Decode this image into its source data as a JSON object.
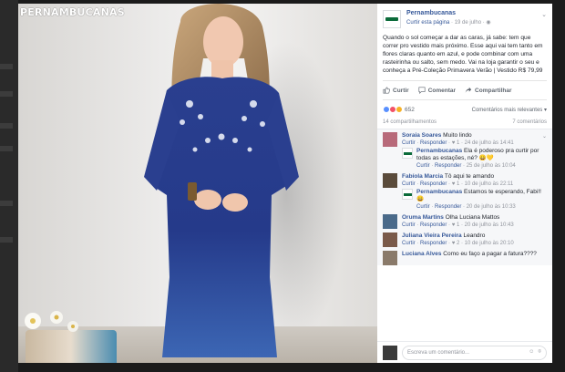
{
  "photo": {
    "brand_logo": "PERNAMBUCANAS"
  },
  "post": {
    "page_name": "Pernambucanas",
    "like_page": "Curtir esta página",
    "date": "· 19 de julho · ",
    "text": "Quando o sol começar a dar as caras, já sabe: tem que correr pro vestido mais próximo. Esse aqui vai tem tanto em flores claras quanto em azul, e pode combinar com uma rasteirinha ou salto, sem medo. Vai na loja garantir o seu e conheça a Pré-Coleção Primavera Verão | Vestido R$ 79,99",
    "actions": {
      "like": "Curtir",
      "comment": "Comentar",
      "share": "Compartilhar"
    },
    "reaction_count": "652",
    "sort_label": "Comentários mais relevantes ▾",
    "shares": "14 compartilhamentos",
    "comments_count": "7 comentários"
  },
  "comments": [
    {
      "name": "Soraia Soares",
      "text": "Muito lindo",
      "meta_like": "Curtir",
      "meta_reply": "Responder",
      "meta_rest": "· ♥ 1 · 24 de julho às 14:41",
      "avatar_color": "#b86a7a",
      "reply": {
        "name": "Pernambucanas",
        "text": "Ela é poderoso pra curtir por todas as estações, né? 😄💛",
        "meta_like": "Curtir",
        "meta_reply": "Responder",
        "meta_rest": "· 25 de julho às 10:04"
      }
    },
    {
      "name": "Fabíola Marcia",
      "text": "Tô aqui te amando",
      "meta_like": "Curtir",
      "meta_reply": "Responder",
      "meta_rest": "· ♥ 1 · 10 de julho às 22:11",
      "avatar_color": "#5a4b3b",
      "reply": {
        "name": "Pernambucanas",
        "text": "Estamos te esperando, Fabi!! 😄",
        "meta_like": "Curtir",
        "meta_reply": "Responder",
        "meta_rest": "· 20 de julho às 10:33"
      }
    },
    {
      "name": "Oruma Martins",
      "text": "Olha Luciana Mattos",
      "meta_like": "Curtir",
      "meta_reply": "Responder",
      "meta_rest": "· ♥ 1 · 20 de julho às 10:43",
      "avatar_color": "#4a6a8a"
    },
    {
      "name": "Juliana Vieira Pereira",
      "text": "Leandro",
      "meta_like": "Curtir",
      "meta_reply": "Responder",
      "meta_rest": "· ♥ 2 · 10 de julho às 20:10",
      "avatar_color": "#7a5a4a"
    },
    {
      "name": "Luciana Alves",
      "text": "Como eu faço a pagar a fatura????",
      "meta_like": "",
      "meta_reply": "",
      "meta_rest": "",
      "avatar_color": "#8a7a6a"
    }
  ],
  "write": {
    "placeholder": "Escreva um comentário..."
  }
}
